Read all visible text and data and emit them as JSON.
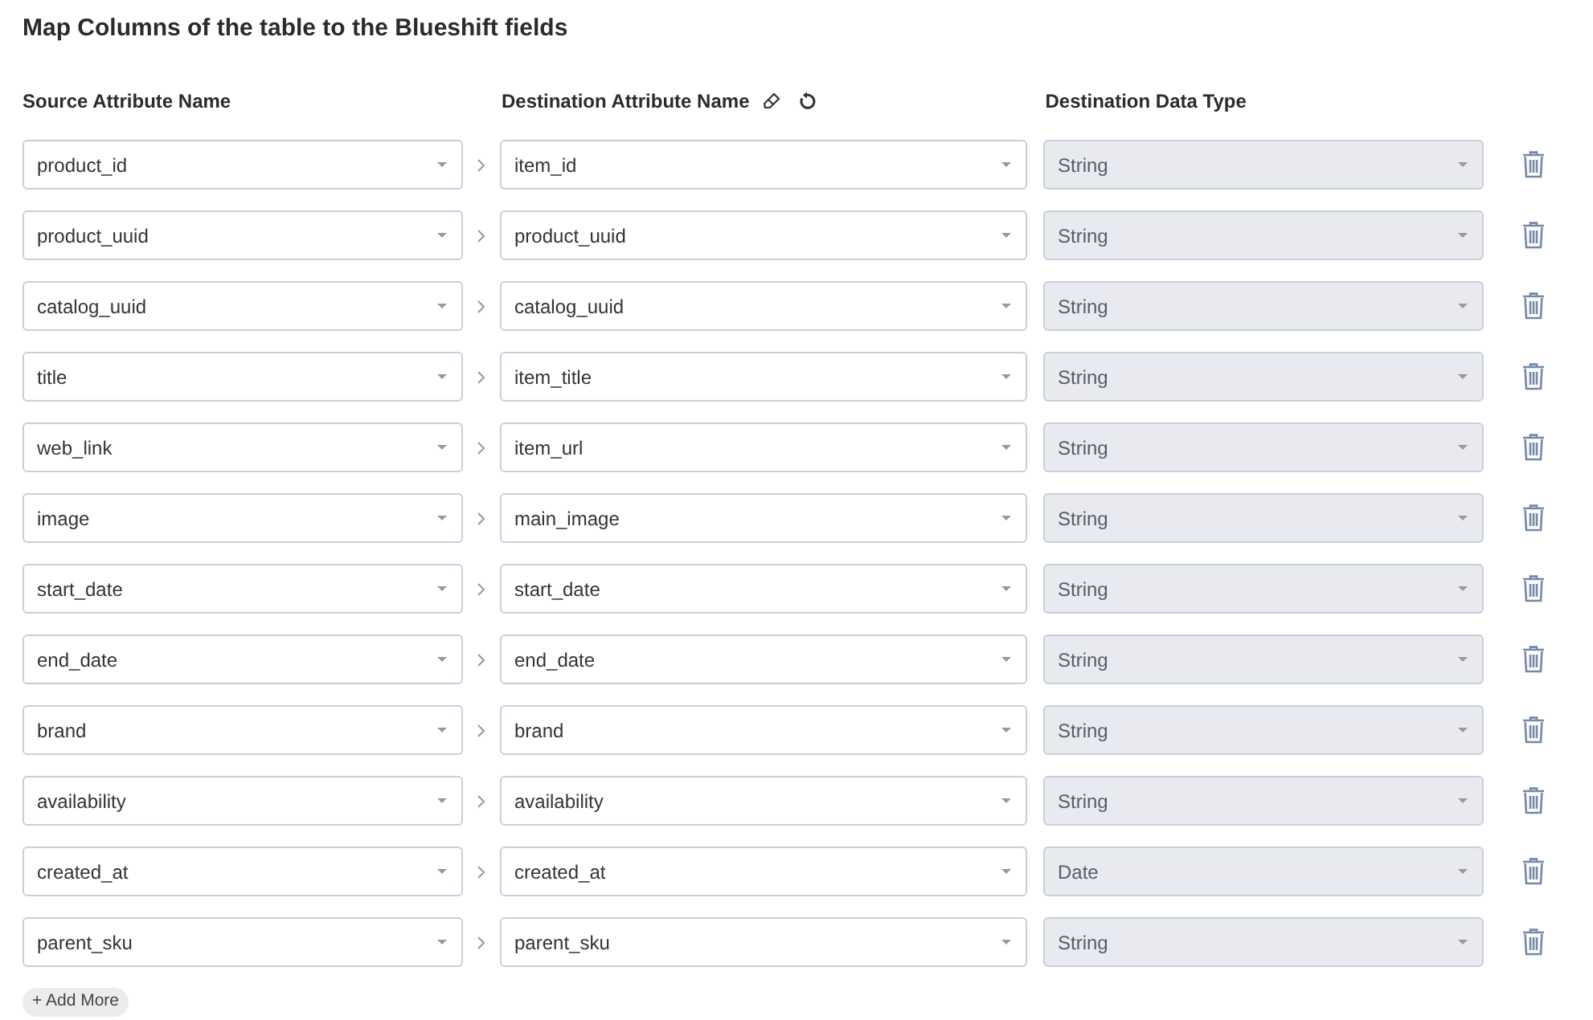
{
  "title": "Map Columns of the table to the Blueshift fields",
  "columns": {
    "source": "Source Attribute Name",
    "destination": "Destination Attribute Name",
    "type": "Destination Data Type"
  },
  "rows": [
    {
      "source": "product_id",
      "destination": "item_id",
      "type": "String",
      "type_disabled": true
    },
    {
      "source": "product_uuid",
      "destination": "product_uuid",
      "type": "String",
      "type_disabled": true
    },
    {
      "source": "catalog_uuid",
      "destination": "catalog_uuid",
      "type": "String",
      "type_disabled": true
    },
    {
      "source": "title",
      "destination": "item_title",
      "type": "String",
      "type_disabled": true
    },
    {
      "source": "web_link",
      "destination": "item_url",
      "type": "String",
      "type_disabled": true
    },
    {
      "source": "image",
      "destination": "main_image",
      "type": "String",
      "type_disabled": true
    },
    {
      "source": "start_date",
      "destination": "start_date",
      "type": "String",
      "type_disabled": true
    },
    {
      "source": "end_date",
      "destination": "end_date",
      "type": "String",
      "type_disabled": true
    },
    {
      "source": "brand",
      "destination": "brand",
      "type": "String",
      "type_disabled": true
    },
    {
      "source": "availability",
      "destination": "availability",
      "type": "String",
      "type_disabled": true
    },
    {
      "source": "created_at",
      "destination": "created_at",
      "type": "Date",
      "type_disabled": true
    },
    {
      "source": "parent_sku",
      "destination": "parent_sku",
      "type": "String",
      "type_disabled": true
    }
  ],
  "add_button": "+ Add More"
}
